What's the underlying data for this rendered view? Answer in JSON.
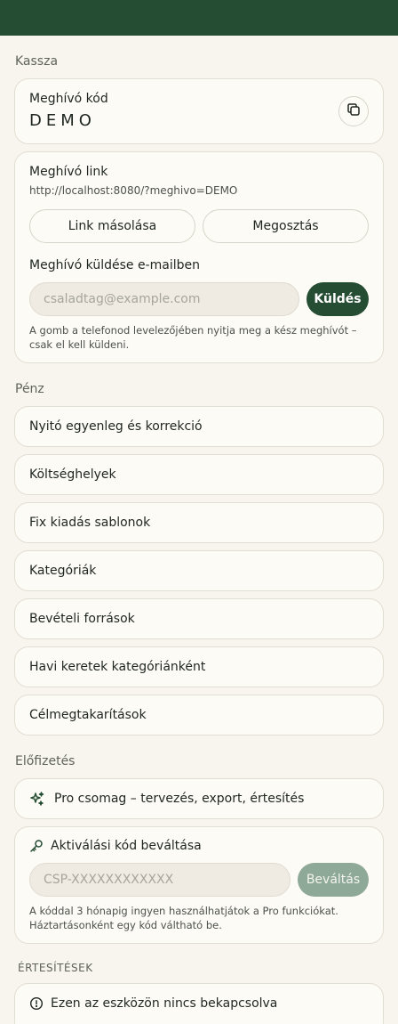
{
  "sections": {
    "kassza": "Kassza",
    "penz": "Pénz",
    "elofizetes": "Előfizetés",
    "ertesitesek": "ÉRTESÍTÉSEK"
  },
  "invite_code": {
    "label": "Meghívó kód",
    "value": "DEMO",
    "copy_icon": "copy-icon"
  },
  "invite_link": {
    "label": "Meghívó link",
    "url": "http://localhost:8080/?meghivo=DEMO",
    "copy_button": "Link másolása",
    "share_button": "Megosztás",
    "email_label": "Meghívó küldése e-mailben",
    "email_placeholder": "csaladtag@example.com",
    "send_button": "Küldés",
    "help_text": "A gomb a telefonod levelezőjében nyitja meg a kész meghívót – csak el kell küldeni."
  },
  "money_items": [
    "Nyitó egyenleg és korrekció",
    "Költséghelyek",
    "Fix kiadás sablonok",
    "Kategóriák",
    "Bevételi források",
    "Havi keretek kategóriánként",
    "Célmegtakarítások"
  ],
  "subscription": {
    "pro_label": "Pro csomag – tervezés, export, értesítés",
    "pro_icon": "sparkle-icon",
    "activation_label": "Aktiválási kód beváltása",
    "activation_icon": "key-icon",
    "code_placeholder": "CSP-XXXXXXXXXXXX",
    "redeem_button": "Beváltás",
    "help_text": "A kóddal 3 hónapig ingyen használhatjátok a Pro funkciókat. Háztartásonként egy kód váltható be."
  },
  "notifications": {
    "status": "Ezen az eszközön nincs bekapcsolva",
    "status_icon": "info-icon"
  },
  "colors": {
    "brand": "#254d33",
    "background": "#f8f5ee",
    "card": "#fdfbf6",
    "muted_button": "#8ea998"
  }
}
